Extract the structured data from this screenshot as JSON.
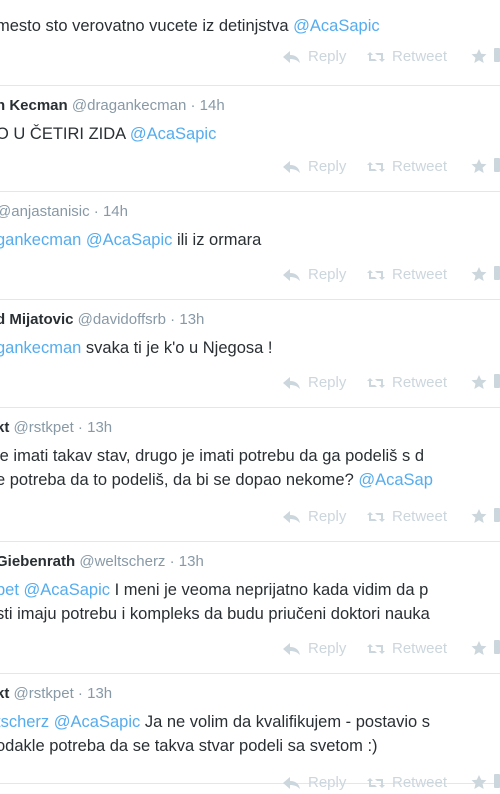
{
  "actions": {
    "reply": "Reply",
    "retweet": "Retweet"
  },
  "tweets": [
    {
      "name": "",
      "handle": "",
      "time": "",
      "lines": [
        [
          {
            "t": "mesto sto verovatno vucete iz detinjstva "
          },
          {
            "t": "@AcaSapic",
            "m": true
          }
        ]
      ]
    },
    {
      "name": "n Kecman",
      "handle": "@dragankecman",
      "time": "14h",
      "lines": [
        [
          {
            "t": "O U ČETIRI ZIDA "
          },
          {
            "t": "@AcaSapic",
            "m": true
          }
        ]
      ]
    },
    {
      "name": "",
      "handle": "@anjastanisic",
      "time": "14h",
      "lines": [
        [
          {
            "t": "gankecman",
            "m": true
          },
          {
            "t": " "
          },
          {
            "t": "@AcaSapic",
            "m": true
          },
          {
            "t": " ili iz ormara"
          }
        ]
      ]
    },
    {
      "name": "d Mijatovic",
      "handle": "@davidoffsrb",
      "time": "13h",
      "lines": [
        [
          {
            "t": "gankecman",
            "m": true
          },
          {
            "t": "  svaka ti je k'o u Njegosa !"
          }
        ]
      ]
    },
    {
      "name": "kt",
      "handle": "@rstkpet",
      "time": "13h",
      "lines": [
        [
          {
            "t": "je imati takav stav, drugo je imati potrebu da ga podeliš s d"
          }
        ],
        [
          {
            "t": "e potreba da to podeliš, da bi se dopao nekome? "
          },
          {
            "t": "@AcaSap",
            "m": true
          }
        ]
      ]
    },
    {
      "name": "Giebenrath",
      "handle": "@weltscherz",
      "time": "13h",
      "lines": [
        [
          {
            "t": "pet",
            "m": true
          },
          {
            "t": " "
          },
          {
            "t": "@AcaSapic",
            "m": true
          },
          {
            "t": " I meni je veoma neprijatno kada vidim da p"
          }
        ],
        [
          {
            "t": "sti imaju potrebu i kompleks da budu priučeni doktori nauka"
          }
        ]
      ]
    },
    {
      "name": "kt",
      "handle": "@rstkpet",
      "time": "13h",
      "lines": [
        [
          {
            "t": "tscherz",
            "m": true
          },
          {
            "t": " "
          },
          {
            "t": "@AcaSapic",
            "m": true
          },
          {
            "t": " Ja ne volim da kvalifikujem - postavio s"
          }
        ],
        [
          {
            "t": "odakle potreba da se takva stvar podeli sa svetom :)"
          }
        ]
      ]
    }
  ]
}
